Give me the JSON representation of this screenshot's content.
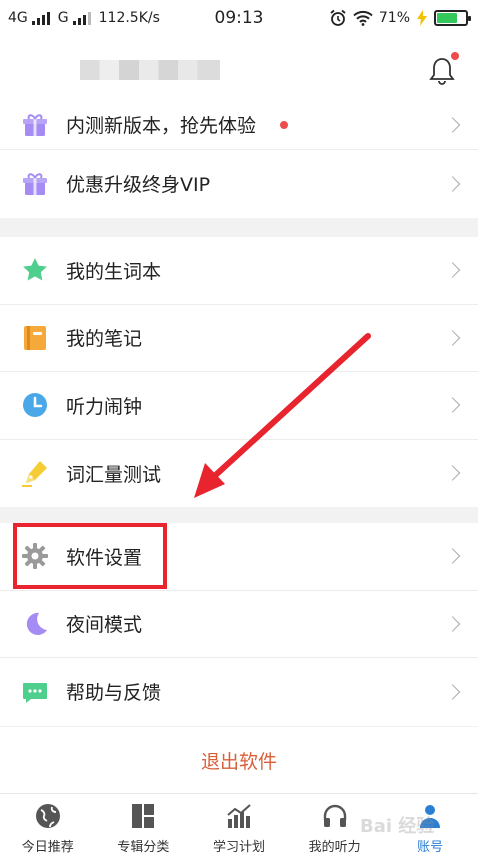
{
  "status_bar": {
    "network1": "4G",
    "network2": "G",
    "speed": "112.5K/s",
    "time": "09:13",
    "battery": "71%",
    "battery_level": 0.71
  },
  "menu_group1": [
    {
      "label": "内测新版本，抢先体验",
      "icon": "gift-icon",
      "color": "#a58cf5",
      "badge": true
    },
    {
      "label": "优惠升级终身VIP",
      "icon": "gift-icon",
      "color": "#a58cf5"
    }
  ],
  "menu_group2": [
    {
      "label": "我的生词本",
      "icon": "star-icon",
      "color": "#4fcf8d"
    },
    {
      "label": "我的笔记",
      "icon": "notebook-icon",
      "color": "#f5a93b"
    },
    {
      "label": "听力闹钟",
      "icon": "clock-icon",
      "color": "#4aa8e8"
    },
    {
      "label": "词汇量测试",
      "icon": "pen-icon",
      "color": "#f5cc33"
    }
  ],
  "menu_group3": [
    {
      "label": "软件设置",
      "icon": "gear-icon",
      "color": "#9a9a9a"
    },
    {
      "label": "夜间模式",
      "icon": "moon-icon",
      "color": "#a58cf5"
    },
    {
      "label": "帮助与反馈",
      "icon": "chat-icon",
      "color": "#4fcf8d"
    }
  ],
  "logout_label": "退出软件",
  "tabs": [
    {
      "label": "今日推荐",
      "icon": "globe-icon"
    },
    {
      "label": "专辑分类",
      "icon": "grid-icon"
    },
    {
      "label": "学习计划",
      "icon": "chart-icon"
    },
    {
      "label": "我的听力",
      "icon": "headphones-icon"
    },
    {
      "label": "账号",
      "icon": "account-icon",
      "active": true
    }
  ],
  "colors": {
    "accent": "#2a7fd4",
    "logout": "#d9603b",
    "highlight": "#e8242e"
  },
  "watermark": "Bai 经验"
}
